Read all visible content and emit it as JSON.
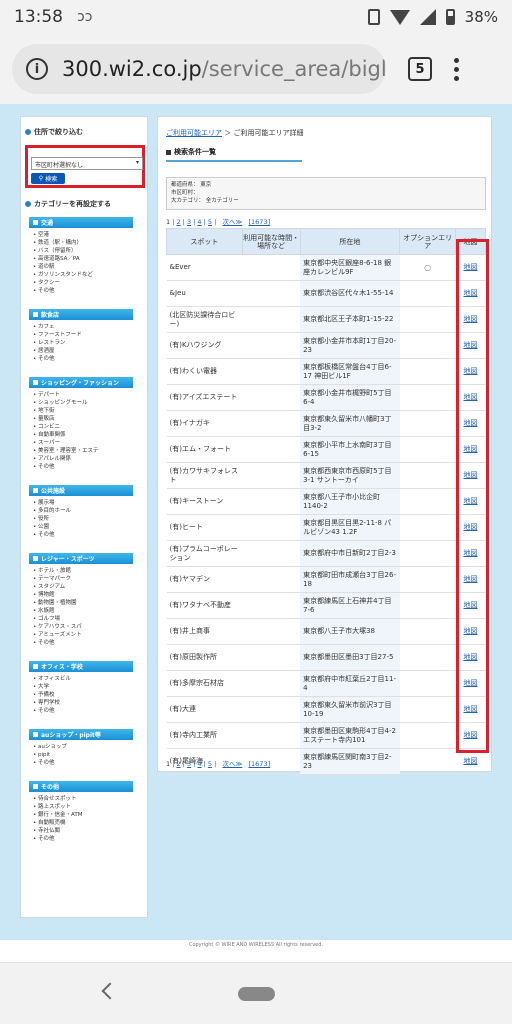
{
  "status": {
    "time": "13:58",
    "battery": "38%"
  },
  "browser": {
    "url_host": "300.wi2.co.jp",
    "url_path": "/service_area/biglob",
    "tab_count": "5"
  },
  "sidebar": {
    "address_filter_heading": "住所で絞り込む",
    "select_value": "市区町村選択なし",
    "search_button": "検索",
    "category_heading": "カテゴリーを再設定する",
    "categories": [
      {
        "title": "交通",
        "items": [
          "空港",
          "鉄道（駅・構内）",
          "バス（停留所）",
          "高速道路SA／PA",
          "道の駅",
          "ガソリンスタンドなど",
          "タクシー",
          "その他"
        ]
      },
      {
        "title": "飲食店",
        "items": [
          "カフェ",
          "ファーストフード",
          "レストラン",
          "居酒屋",
          "その他"
        ]
      },
      {
        "title": "ショッピング・ファッション",
        "items": [
          "デパート",
          "ショッピングモール",
          "地下街",
          "量販店",
          "コンビニ",
          "自動車関係",
          "スーパー",
          "美容室・理容室・エステ",
          "アパレル関係",
          "その他"
        ]
      },
      {
        "title": "公共施設",
        "items": [
          "展示場",
          "多目的ホール",
          "役所",
          "公園",
          "その他"
        ]
      },
      {
        "title": "レジャー・スポーツ",
        "items": [
          "ホテル・旅館",
          "テーマパーク",
          "スタジアム",
          "博物館",
          "動物園・植物園",
          "水族館",
          "ゴルフ場",
          "ケアハウス・スパ",
          "アミューズメント",
          "その他"
        ]
      },
      {
        "title": "オフィス・学校",
        "items": [
          "オフィスビル",
          "大学",
          "予備校",
          "専門学校",
          "その他"
        ]
      },
      {
        "title": "auショップ・pipit等",
        "items": [
          "auショップ",
          "pipit",
          "その他"
        ]
      },
      {
        "title": "その他",
        "items": [
          "待合せスポット",
          "路上スポット",
          "銀行・信金・ATM",
          "自動販売機",
          "寺社仏閣",
          "その他"
        ]
      }
    ]
  },
  "main": {
    "breadcrumb_link": "ご利用可能エリア",
    "breadcrumb_current": " ＞ ご利用可能エリア詳細",
    "conditions_title": "検索条件一覧",
    "conditions": [
      "都道府県： 東京",
      "市区町村：",
      "大カテゴリ： 全カテゴリー"
    ],
    "pager": {
      "current": "1",
      "pages": [
        "2",
        "3",
        "4",
        "5"
      ],
      "next": "次へ≫",
      "total": "[1673]"
    },
    "table": {
      "headers": [
        "スポット",
        "利用可能な時間・場所など",
        "所在地",
        "オプションエリア",
        "地図"
      ],
      "rows": [
        {
          "spot": "&Ever",
          "address": "東京都中央区銀座8-6-18 銀座カレンビル9F",
          "option": "○",
          "map": "地図"
        },
        {
          "spot": "&Jeu",
          "address": "東京都渋谷区代々木1-55-14",
          "option": "",
          "map": "地図"
        },
        {
          "spot": "(北区防災課待合ロビー)",
          "address": "東京都北区王子本町1-15-22",
          "option": "",
          "map": "地図"
        },
        {
          "spot": "(有)Kハウジング",
          "address": "東京都小金井市本町1丁目20-23",
          "option": "",
          "map": "地図"
        },
        {
          "spot": "(有)わくい電器",
          "address": "東京都板橋区常盤台4丁目6-17 神田ビル1F",
          "option": "",
          "map": "地図"
        },
        {
          "spot": "(有)アイズエステート",
          "address": "東京都小金井市梶野町5丁目6-4",
          "option": "",
          "map": "地図"
        },
        {
          "spot": "(有)イナガキ",
          "address": "東京都東久留米市八幡町3丁目3-2",
          "option": "",
          "map": "地図"
        },
        {
          "spot": "(有)エム・フォート",
          "address": "東京都小平市上水南町3丁目6-15",
          "option": "",
          "map": "地図"
        },
        {
          "spot": "(有)カワサキフォレスト",
          "address": "東京都西東京市西原町5丁目3-1 サントーカイ",
          "option": "",
          "map": "地図"
        },
        {
          "spot": "(有)キーストーン",
          "address": "東京都八王子市小比企町1140-2",
          "option": "",
          "map": "地図"
        },
        {
          "spot": "(有)ヒート",
          "address": "東京都目黒区目黒2-11-8 パルビゾン43 1.2F",
          "option": "",
          "map": "地図"
        },
        {
          "spot": "(有)プラムコーポレーション",
          "address": "東京都府中市日新町2丁目2-3",
          "option": "",
          "map": "地図"
        },
        {
          "spot": "(有)ヤマデン",
          "address": "東京都町田市成瀬台3丁目26-18",
          "option": "",
          "map": "地図"
        },
        {
          "spot": "(有)ワタナベ不動産",
          "address": "東京都練馬区上石神井4丁目7-6",
          "option": "",
          "map": "地図"
        },
        {
          "spot": "(有)井上商事",
          "address": "東京都八王子市大塚38",
          "option": "",
          "map": "地図"
        },
        {
          "spot": "(有)原田製作所",
          "address": "東京都墨田区墨田3丁目27-5",
          "option": "",
          "map": "地図"
        },
        {
          "spot": "(有)多摩宗石材店",
          "address": "東京都府中市紅葉丘2丁目11-4",
          "option": "",
          "map": "地図"
        },
        {
          "spot": "(有)大連",
          "address": "東京都東久留米市前沢3丁目10-19",
          "option": "",
          "map": "地図"
        },
        {
          "spot": "(有)寺内工業所",
          "address": "東京都墨田区東駒形4丁目4-2 エステート寺内101",
          "option": "",
          "map": "地図"
        },
        {
          "spot": "(有)尾崎海",
          "address": "東京都練馬区関町南3丁目2-23",
          "option": "",
          "map": "地図"
        }
      ]
    }
  },
  "footer": {
    "copyright": "Copyright © WIRE AND WIRELESS All rights reserved."
  }
}
